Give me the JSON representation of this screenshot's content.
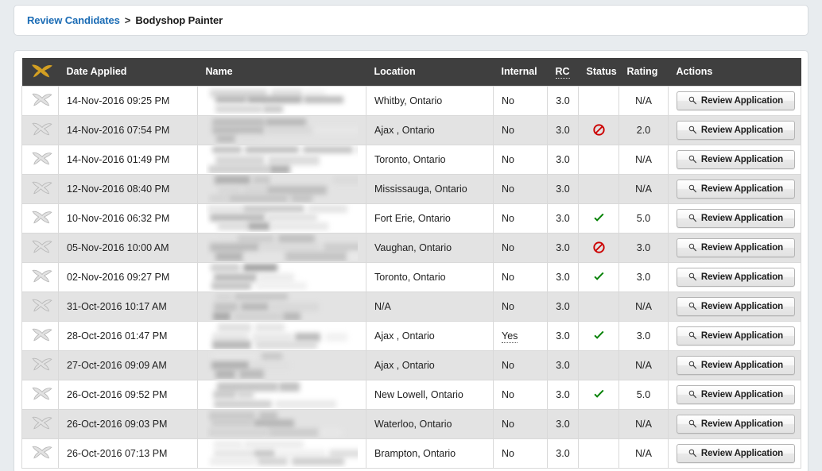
{
  "breadcrumb": {
    "link_label": "Review Candidates",
    "separator": ">",
    "current_label": "Bodyshop Painter"
  },
  "table": {
    "logo_icon": "hawk-logo-icon",
    "columns": {
      "icon": "",
      "date_applied": "Date Applied",
      "name": "Name",
      "location": "Location",
      "internal": "Internal",
      "rc": "RC",
      "status": "Status",
      "rating": "Rating",
      "actions": "Actions"
    },
    "active_sort_column": "Status",
    "accent_color": "#0c7cc0",
    "header_bg": "#3f3f3f",
    "logo_color": "#d39f22",
    "status_ok_color": "#008000",
    "status_denied_color": "#cc0000",
    "row_action_label": "Review Application",
    "row_action_icon": "magnifier-icon",
    "rows": [
      {
        "row_icon": "hawk-row-icon",
        "date_applied": "14-Nov-2016 09:25 PM",
        "name": "",
        "name_redacted": true,
        "location": "Whitby, Ontario",
        "internal": "No",
        "internal_dotted": false,
        "rc": "3.0",
        "status": "",
        "rating": "N/A",
        "action": "Review Application"
      },
      {
        "row_icon": "hawk-row-icon",
        "date_applied": "14-Nov-2016 07:54 PM",
        "name": "",
        "name_redacted": true,
        "location": "Ajax , Ontario",
        "internal": "No",
        "internal_dotted": false,
        "rc": "3.0",
        "status": "denied",
        "rating": "2.0",
        "action": "Review Application"
      },
      {
        "row_icon": "hawk-row-icon",
        "date_applied": "14-Nov-2016 01:49 PM",
        "name": "",
        "name_redacted": true,
        "location": "Toronto, Ontario",
        "internal": "No",
        "internal_dotted": false,
        "rc": "3.0",
        "status": "",
        "rating": "N/A",
        "action": "Review Application"
      },
      {
        "row_icon": "hawk-row-icon",
        "date_applied": "12-Nov-2016 08:40 PM",
        "name": "",
        "name_redacted": true,
        "location": "Mississauga, Ontario",
        "internal": "No",
        "internal_dotted": false,
        "rc": "3.0",
        "status": "",
        "rating": "N/A",
        "action": "Review Application"
      },
      {
        "row_icon": "hawk-row-icon",
        "date_applied": "10-Nov-2016 06:32 PM",
        "name": "",
        "name_redacted": true,
        "location": "Fort Erie, Ontario",
        "internal": "No",
        "internal_dotted": false,
        "rc": "3.0",
        "status": "approved",
        "rating": "5.0",
        "action": "Review Application"
      },
      {
        "row_icon": "hawk-row-icon",
        "date_applied": "05-Nov-2016 10:00 AM",
        "name": "",
        "name_redacted": true,
        "location": "Vaughan, Ontario",
        "internal": "No",
        "internal_dotted": false,
        "rc": "3.0",
        "status": "denied",
        "rating": "3.0",
        "action": "Review Application"
      },
      {
        "row_icon": "hawk-row-icon",
        "date_applied": "02-Nov-2016 09:27 PM",
        "name": "",
        "name_redacted": true,
        "location": "Toronto, Ontario",
        "internal": "No",
        "internal_dotted": false,
        "rc": "3.0",
        "status": "approved",
        "rating": "3.0",
        "action": "Review Application"
      },
      {
        "row_icon": "hawk-row-icon",
        "date_applied": "31-Oct-2016 10:17 AM",
        "name": "",
        "name_redacted": true,
        "location": "N/A",
        "internal": "No",
        "internal_dotted": false,
        "rc": "3.0",
        "status": "",
        "rating": "N/A",
        "action": "Review Application"
      },
      {
        "row_icon": "hawk-row-icon",
        "date_applied": "28-Oct-2016 01:47 PM",
        "name": "",
        "name_redacted": true,
        "location": "Ajax , Ontario",
        "internal": "Yes",
        "internal_dotted": true,
        "rc": "3.0",
        "status": "approved",
        "rating": "3.0",
        "action": "Review Application"
      },
      {
        "row_icon": "hawk-row-icon",
        "date_applied": "27-Oct-2016 09:09 AM",
        "name": "",
        "name_redacted": true,
        "location": "Ajax , Ontario",
        "internal": "No",
        "internal_dotted": false,
        "rc": "3.0",
        "status": "",
        "rating": "N/A",
        "action": "Review Application"
      },
      {
        "row_icon": "hawk-row-icon",
        "date_applied": "26-Oct-2016 09:52 PM",
        "name": "",
        "name_redacted": true,
        "location": "New Lowell, Ontario",
        "internal": "No",
        "internal_dotted": false,
        "rc": "3.0",
        "status": "approved",
        "rating": "5.0",
        "action": "Review Application"
      },
      {
        "row_icon": "hawk-row-icon",
        "date_applied": "26-Oct-2016 09:03 PM",
        "name": "",
        "name_redacted": true,
        "location": "Waterloo, Ontario",
        "internal": "No",
        "internal_dotted": false,
        "rc": "3.0",
        "status": "",
        "rating": "N/A",
        "action": "Review Application"
      },
      {
        "row_icon": "hawk-row-icon",
        "date_applied": "26-Oct-2016 07:13 PM",
        "name": "",
        "name_redacted": true,
        "location": "Brampton, Ontario",
        "internal": "No",
        "internal_dotted": false,
        "rc": "3.0",
        "status": "",
        "rating": "N/A",
        "action": "Review Application"
      }
    ]
  }
}
